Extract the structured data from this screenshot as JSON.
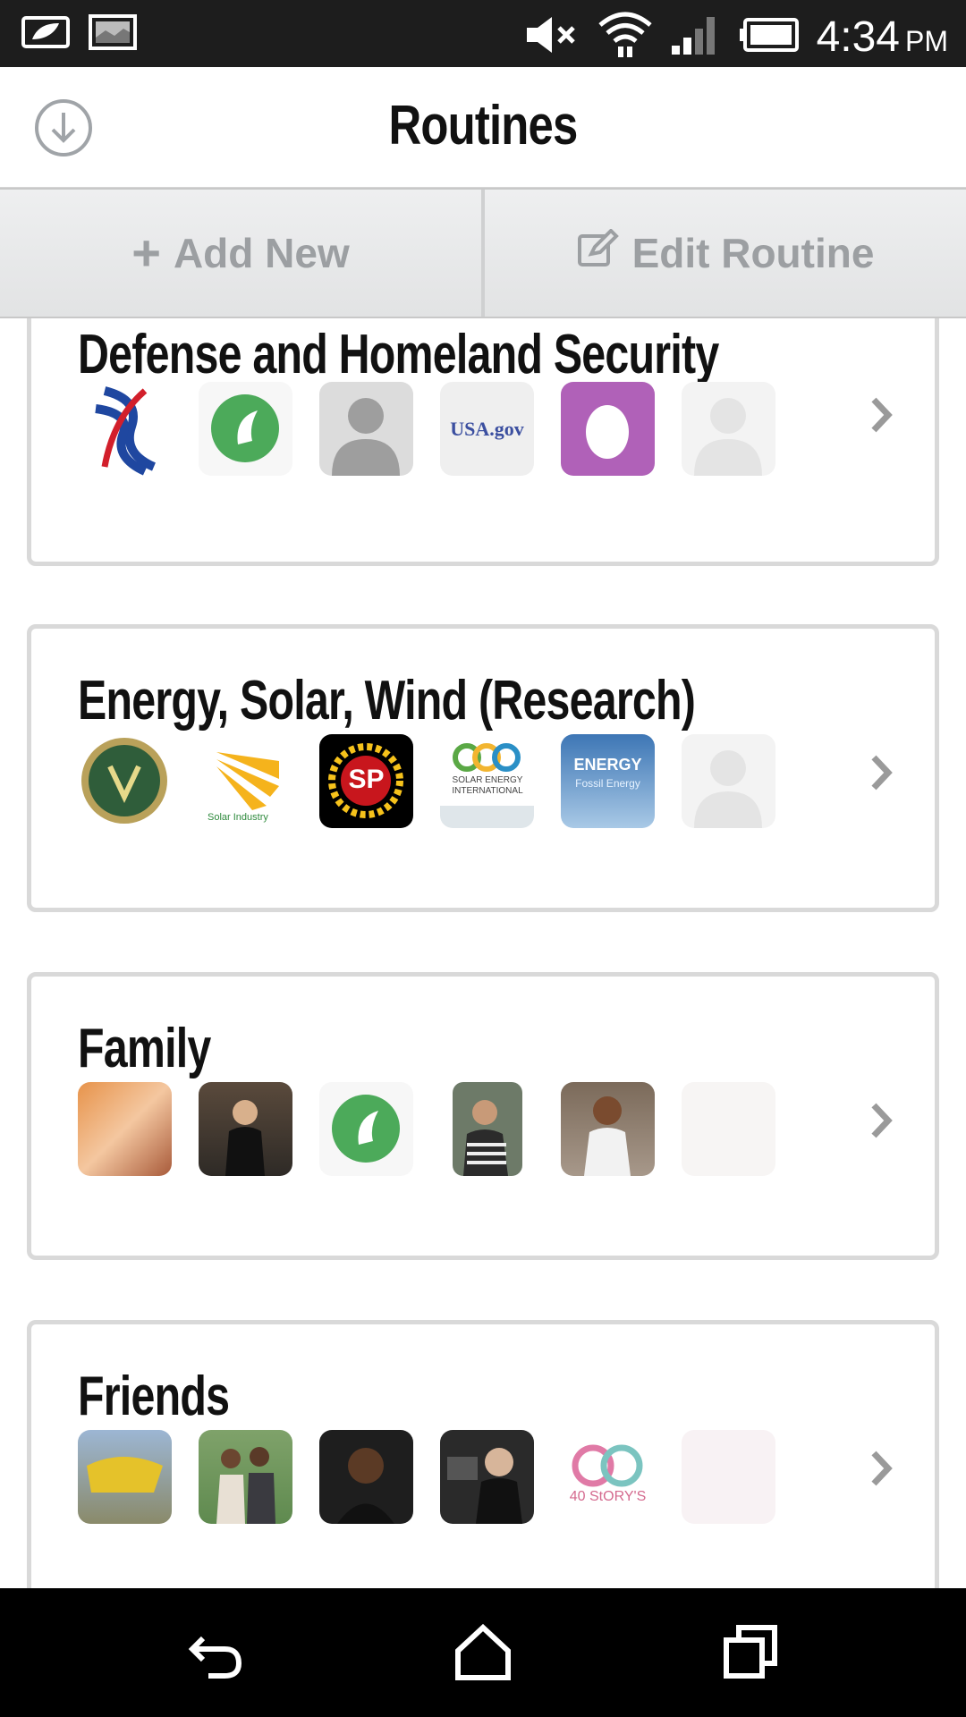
{
  "status_bar": {
    "time": "4:34",
    "ampm": "PM",
    "icons": [
      "battery-saver-icon",
      "image-icon",
      "mute-icon",
      "wifi-icon",
      "signal-icon",
      "battery-icon"
    ]
  },
  "header": {
    "title": "Routines",
    "download_icon": "download-circle-icon"
  },
  "actions": {
    "add_label": "Add New",
    "edit_label": "Edit Routine"
  },
  "routines": [
    {
      "title": "Defense and Homeland Security",
      "avatars": [
        "dhs-logo",
        "green-leaf-logo",
        "default-person",
        "usa-gov-logo",
        "egg-avatar",
        "faded-person"
      ]
    },
    {
      "title": "Energy, Solar, Wind (Research)",
      "avatars": [
        "energy-seal",
        "solar-industry-logo",
        "sp-logo",
        "solar-energy-international-logo",
        "energy-fossil-logo",
        "faded-person"
      ]
    },
    {
      "title": "Family",
      "avatars": [
        "family-photo-1",
        "family-photo-2",
        "green-leaf-logo",
        "family-photo-3",
        "family-photo-4",
        "faded-photo"
      ]
    },
    {
      "title": "Friends",
      "avatars": [
        "friends-photo-1",
        "friends-photo-2",
        "friends-photo-3",
        "friends-photo-4",
        "40-storys-logo",
        "faded-photo"
      ]
    }
  ],
  "avatar_texts": {
    "usa_gov": "USA.gov",
    "sp": "SP",
    "solar_industry": "Solar Industry",
    "solar_energy_intl": "SOLAR ENERGY INTERNATIONAL",
    "energy": "ENERGY",
    "fossil": "Fossil Energy",
    "storys": "40 StORY'S"
  },
  "nav": [
    "back-icon",
    "home-icon",
    "recents-icon"
  ]
}
